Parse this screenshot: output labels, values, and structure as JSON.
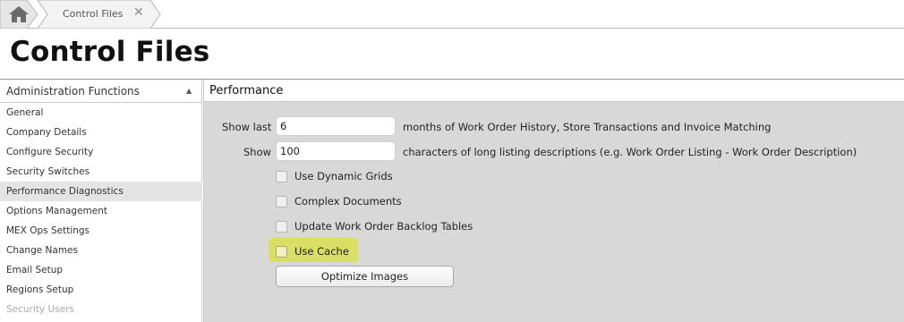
{
  "tabs": {
    "home_icon": "home-icon",
    "items": [
      {
        "label": "Control Files",
        "close": "✕"
      }
    ]
  },
  "page": {
    "title": "Control Files"
  },
  "sidebar": {
    "header": "Administration Functions",
    "collapse_glyph": "▲",
    "items": [
      {
        "label": "General"
      },
      {
        "label": "Company Details"
      },
      {
        "label": "Configure Security"
      },
      {
        "label": "Security Switches"
      },
      {
        "label": "Performance Diagnostics",
        "selected": true
      },
      {
        "label": "Options Management"
      },
      {
        "label": "MEX Ops Settings"
      },
      {
        "label": "Change Names"
      },
      {
        "label": "Email Setup"
      },
      {
        "label": "Regions Setup"
      },
      {
        "label": "Security Users"
      }
    ]
  },
  "panel": {
    "title": "Performance",
    "show_last": {
      "label": "Show last",
      "value": "6",
      "suffix": "months of Work Order History, Store Transactions and Invoice Matching"
    },
    "show_chars": {
      "label": "Show",
      "value": "100",
      "suffix": "characters of long listing descriptions (e.g. Work Order Listing - Work Order Description)"
    },
    "checkboxes": [
      {
        "label": "Use Dynamic Grids",
        "checked": false
      },
      {
        "label": "Complex Documents",
        "checked": false
      },
      {
        "label": "Update Work Order Backlog Tables",
        "checked": false
      },
      {
        "label": "Use Cache",
        "checked": false,
        "highlighted": true
      }
    ],
    "optimize_button": "Optimize Images"
  },
  "colors": {
    "highlight": "#d9de64",
    "panel_bg": "#d8d8d8",
    "selected_item_bg": "#e4e4e4"
  }
}
